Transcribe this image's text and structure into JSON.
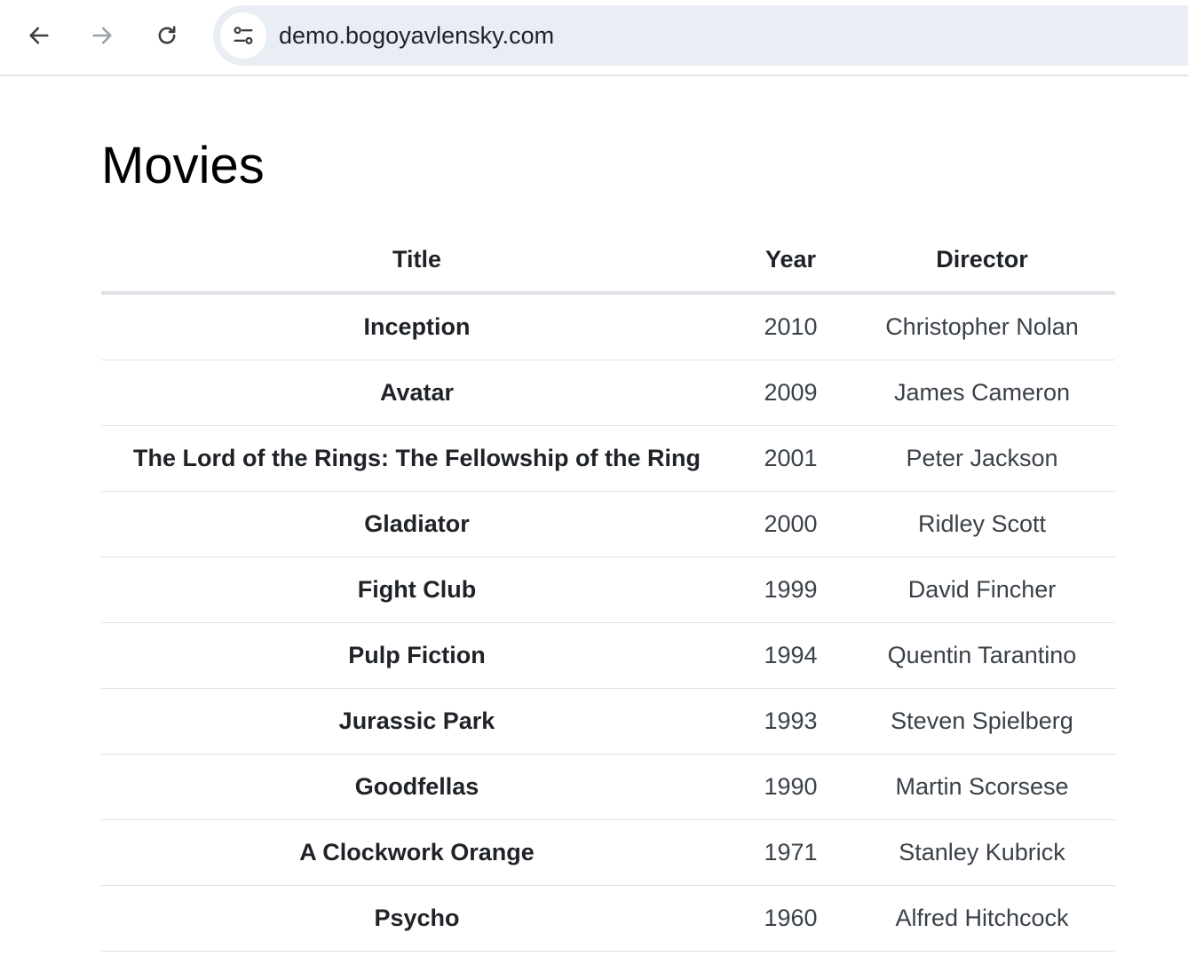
{
  "browser": {
    "url": "demo.bogoyavlensky.com",
    "back_icon": "arrow-left-icon",
    "forward_icon": "arrow-right-icon",
    "reload_icon": "reload-icon",
    "site_info_icon": "tune-icon"
  },
  "page": {
    "title": "Movies"
  },
  "table": {
    "headers": {
      "title": "Title",
      "year": "Year",
      "director": "Director"
    },
    "rows": [
      {
        "title": "Inception",
        "year": "2010",
        "director": "Christopher Nolan"
      },
      {
        "title": "Avatar",
        "year": "2009",
        "director": "James Cameron"
      },
      {
        "title": "The Lord of the Rings: The Fellowship of the Ring",
        "year": "2001",
        "director": "Peter Jackson"
      },
      {
        "title": "Gladiator",
        "year": "2000",
        "director": "Ridley Scott"
      },
      {
        "title": "Fight Club",
        "year": "1999",
        "director": "David Fincher"
      },
      {
        "title": "Pulp Fiction",
        "year": "1994",
        "director": "Quentin Tarantino"
      },
      {
        "title": "Jurassic Park",
        "year": "1993",
        "director": "Steven Spielberg"
      },
      {
        "title": "Goodfellas",
        "year": "1990",
        "director": "Martin Scorsese"
      },
      {
        "title": "A Clockwork Orange",
        "year": "1971",
        "director": "Stanley Kubrick"
      },
      {
        "title": "Psycho",
        "year": "1960",
        "director": "Alfred Hitchcock"
      }
    ]
  },
  "colors": {
    "omnibox_bg": "#e9edf4",
    "border": "#dee2e6",
    "text": "#1f2328",
    "muted_text": "#3a4149"
  }
}
